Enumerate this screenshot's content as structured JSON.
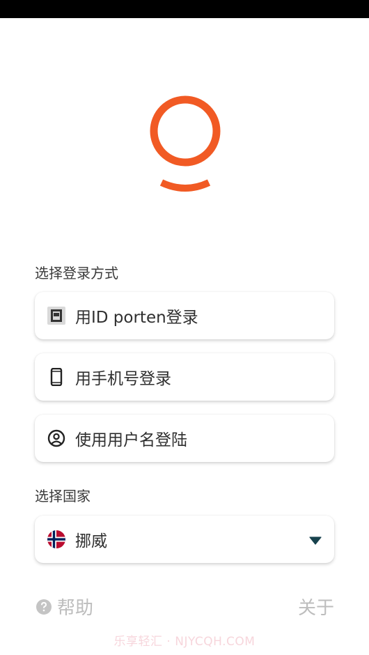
{
  "brand": {
    "logo_color": "#f15a24",
    "logo_icon": "logo-ring-icon"
  },
  "login": {
    "section_label": "选择登录方式",
    "options": [
      {
        "label": "用ID porten登录",
        "icon": "id-porten-icon"
      },
      {
        "label": "用手机号登录",
        "icon": "smartphone-icon"
      },
      {
        "label": "使用用户名登陆",
        "icon": "account-circle-icon"
      }
    ]
  },
  "country": {
    "section_label": "选择国家",
    "selected": "挪威",
    "flag_icon": "norway-flag-icon",
    "caret_icon": "dropdown-caret-icon",
    "caret_color": "#17424d"
  },
  "footer": {
    "help_label": "帮助",
    "help_icon": "help-circle-icon",
    "about_label": "关于",
    "watermark": "乐享轻汇 · NJYCQH.COM"
  }
}
